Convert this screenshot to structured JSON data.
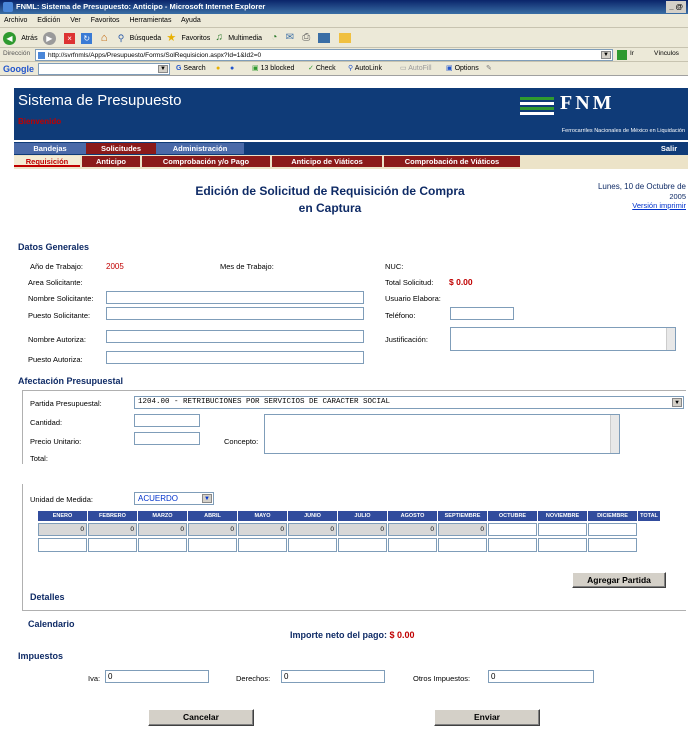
{
  "window": {
    "title": "FNML: Sistema de Presupuesto: Anticipo - Microsoft Internet Explorer",
    "controls": "_ @"
  },
  "menu": [
    "Archivo",
    "Edición",
    "Ver",
    "Favoritos",
    "Herramientas",
    "Ayuda"
  ],
  "toolbar": {
    "back": "Atrás",
    "search": "Búsqueda",
    "favorites": "Favoritos",
    "multimedia": "Multimedia"
  },
  "address": {
    "label": "Dirección",
    "url": "http://svrfnmls/Apps/Presupuesto/Forms/SolRequisicion.aspx?Id=1&Id2=0",
    "go": "Ir",
    "links": "Vínculos"
  },
  "google": {
    "logo": "Google",
    "search": "Search",
    "blocked": "13 blocked",
    "check": "Check",
    "autolink": "AutoLink",
    "autofill": "AutoFill",
    "options": "Options"
  },
  "app": {
    "title": "Sistema de Presupuesto",
    "welcome": "Bienvenido",
    "logo": "FNM",
    "logo_sub": "Ferrocarriles Nacionales de México en Liquidación",
    "exit": "Salir"
  },
  "tabs_main": [
    "Bandejas",
    "Solicitudes",
    "Administración"
  ],
  "tabs_sub": [
    "Requisición",
    "Anticipo",
    "Comprobación y/o Pago",
    "Anticipo de Viáticos",
    "Comprobación de Viáticos"
  ],
  "page": {
    "title": "Edición de Solicitud de Requisición de Compra",
    "subtitle": "en Captura",
    "date": "Lunes, 10 de Octubre de",
    "year": "2005",
    "print": "Versión imprimir"
  },
  "general": {
    "heading": "Datos Generales",
    "anio_label": "Año de Trabajo:",
    "anio_value": "2005",
    "mes_label": "Mes de Trabajo:",
    "nuc_label": "NUC:",
    "area_label": "Area Solicitante:",
    "total_label": "Total Solicitud:",
    "total_value": "$ 0.00",
    "nombre_sol_label": "Nombre Solicitante:",
    "usuario_label": "Usuario Elabora:",
    "puesto_sol_label": "Puesto Solicitante:",
    "telefono_label": "Teléfono:",
    "nombre_aut_label": "Nombre Autoriza:",
    "justificacion_label": "Justificación:",
    "puesto_aut_label": "Puesto Autoriza:"
  },
  "afectacion": {
    "heading": "Afectación Presupuestal",
    "partida_label": "Partida Presupuestal:",
    "partida_value": "1204.00 - RETRIBUCIONES POR SERVICIOS DE CARACTER SOCIAL",
    "cantidad_label": "Cantidad:",
    "precio_label": "Precio Unitario:",
    "concepto_label": "Concepto:",
    "total_label": "Total:"
  },
  "unidad": {
    "label": "Unidad de Medida:",
    "value": "ACUERDO"
  },
  "months": [
    "ENERO",
    "FEBRERO",
    "MARZO",
    "ABRIL",
    "MAYO",
    "JUNIO",
    "JULIO",
    "AGOSTO",
    "SEPTIEMBRE",
    "OCTUBRE",
    "NOVIEMBRE",
    "DICIEMBRE",
    "TOTAL"
  ],
  "month_values": [
    "0",
    "0",
    "0",
    "0",
    "0",
    "0",
    "0",
    "0",
    "0",
    "",
    "",
    "",
    ""
  ],
  "agregar": "Agregar Partida",
  "detalles": "Detalles",
  "calendario": "Calendario",
  "importe": {
    "label": "Importe neto del pago:",
    "value": "$ 0.00"
  },
  "impuestos": {
    "heading": "Impuestos",
    "iva_label": "Iva:",
    "iva_value": "0",
    "derechos_label": "Derechos:",
    "derechos_value": "0",
    "otros_label": "Otros Impuestos:",
    "otros_value": "0"
  },
  "buttons": {
    "cancel": "Cancelar",
    "send": "Enviar"
  },
  "colors": {
    "title_bar": "#0a246a",
    "app_header": "#0f3b78",
    "accent_red": "#c00000",
    "tab_bar": "#8b1a1a",
    "month_header": "#314c9d"
  }
}
